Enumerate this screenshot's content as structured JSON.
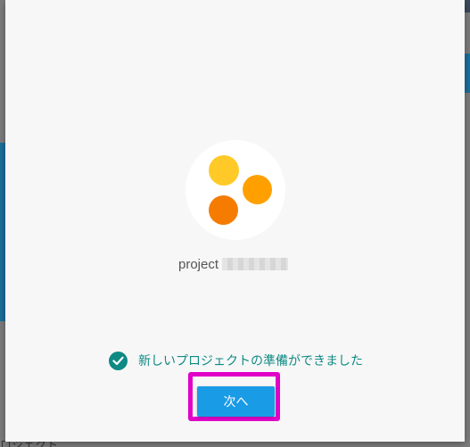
{
  "project": {
    "name_prefix": "project"
  },
  "status": {
    "ready_message": "新しいプロジェクトの準備ができました",
    "icon": "check-circle-icon"
  },
  "actions": {
    "next_label": "次へ"
  },
  "background": {
    "partial_text": "ロジェクト"
  },
  "colors": {
    "accent": "#0e8a84",
    "button": "#1a9be6",
    "highlight": "#e100c8",
    "logo_yellow": "#ffca28",
    "logo_orange": "#ffa000",
    "logo_dark_orange": "#f57c00"
  }
}
